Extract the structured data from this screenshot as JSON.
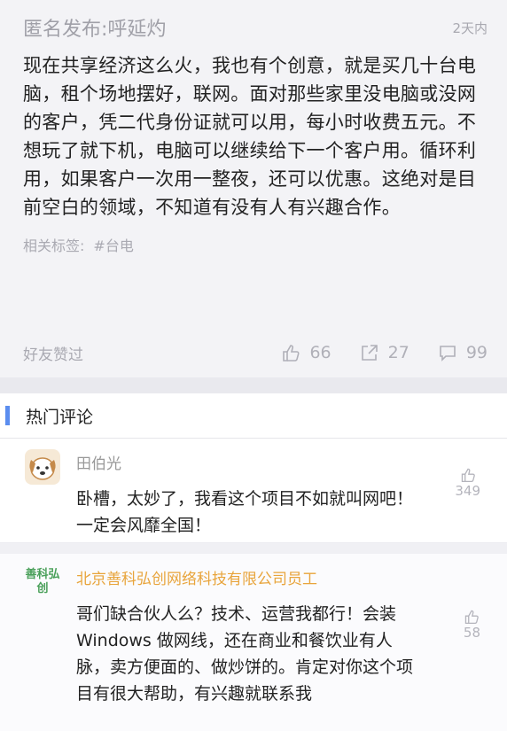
{
  "post": {
    "author": "匿名发布:呼延灼",
    "time": "2天内",
    "content": "现在共享经济这么火，我也有个创意，就是买几十台电脑，租个场地摆好，联网。面对那些家里没电脑或没网的客户，凭二代身份证就可以用，每小时收费五元。不想玩了就下机，电脑可以继续给下一个客户用。循环利用，如果客户一次用一整夜，还可以优惠。这绝对是目前空白的领域，不知道有没有人有兴趣合作。",
    "tags_label": "相关标签:",
    "tag": "#台电",
    "friends_label": "好友赞过",
    "likes": "66",
    "shares": "27",
    "comments": "99"
  },
  "hot_comments": {
    "title": "热门评论",
    "items": [
      {
        "name": "田伯光",
        "text": "卧槽，太妙了，我看这个项目不如就叫网吧！一定会风靡全国！",
        "likes": "349"
      },
      {
        "name": "北京善科弘创网络科技有限公司员工",
        "avatar_text": "善科弘创",
        "text": "哥们缺合伙人么？技术、运营我都行！会装Windows 做网线，还在商业和餐饮业有人脉，卖方便面的、做炒饼的。肯定对你这个项目有很大帮助，有兴趣就联系我",
        "likes": "58"
      }
    ]
  },
  "colors": {
    "accent": "#5b8def",
    "company_name": "#e8a43b"
  }
}
